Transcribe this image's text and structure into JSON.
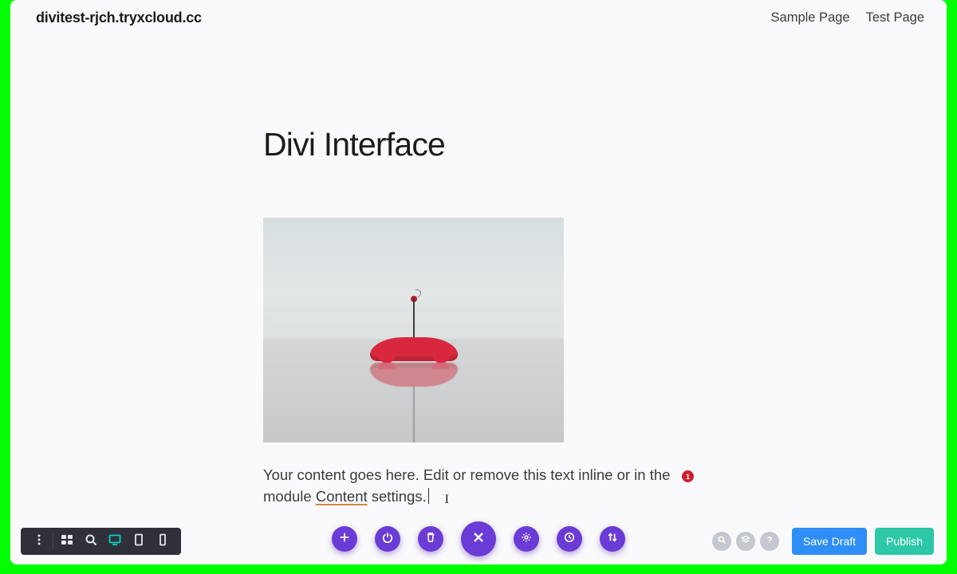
{
  "header": {
    "site_title": "divitest-rjch.tryxcloud.cc",
    "nav": {
      "sample": "Sample Page",
      "test": "Test Page"
    }
  },
  "page": {
    "title": "Divi Interface",
    "body_pre": "Your content goes here. Edit or remove this text inline or in the module ",
    "body_spell": "Content",
    "body_post": " settings.",
    "notification_count": "1"
  },
  "center_toolbar": {
    "add": "add",
    "power": "power",
    "trash": "trash",
    "close": "close",
    "gear": "gear",
    "clock": "clock",
    "sort": "sort"
  },
  "left_toolbar": {
    "more": "more",
    "grid": "grid",
    "zoom": "zoom",
    "desktop": "desktop",
    "tablet": "tablet",
    "phone": "phone"
  },
  "right": {
    "icons": {
      "search": "search",
      "layers": "layers",
      "help": "help"
    },
    "save_draft": "Save Draft",
    "publish": "Publish"
  }
}
